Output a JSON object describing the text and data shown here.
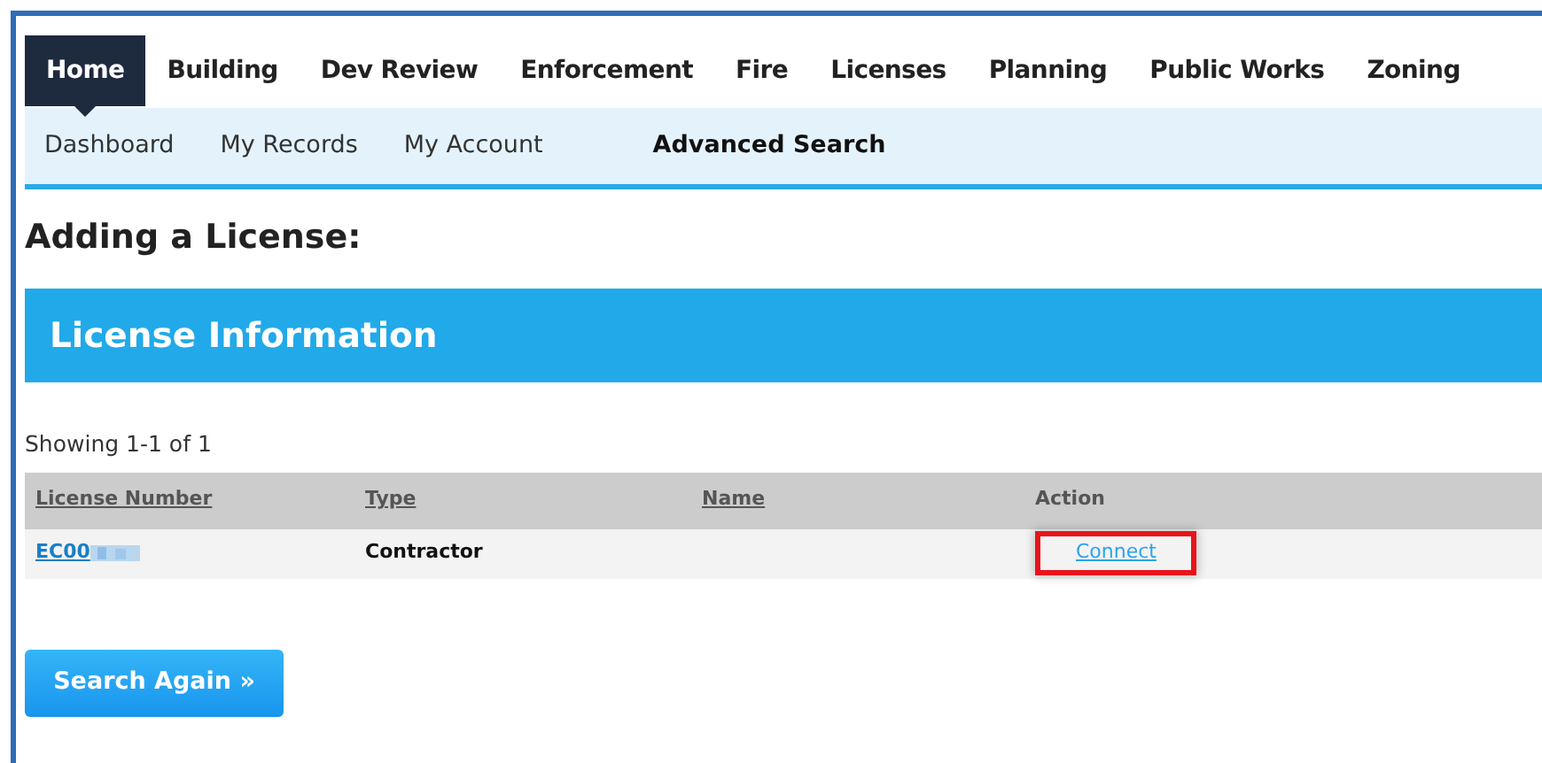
{
  "main_nav": [
    {
      "label": "Home",
      "selected": true
    },
    {
      "label": "Building",
      "selected": false
    },
    {
      "label": "Dev Review",
      "selected": false
    },
    {
      "label": "Enforcement",
      "selected": false
    },
    {
      "label": "Fire",
      "selected": false
    },
    {
      "label": "Licenses",
      "selected": false
    },
    {
      "label": "Planning",
      "selected": false
    },
    {
      "label": "Public Works",
      "selected": false
    },
    {
      "label": "Zoning",
      "selected": false
    }
  ],
  "sub_nav": [
    {
      "label": "Dashboard",
      "emphasized": false
    },
    {
      "label": "My Records",
      "emphasized": false
    },
    {
      "label": "My Account",
      "emphasized": false
    },
    {
      "label": "Advanced Search",
      "emphasized": true
    }
  ],
  "page_title": "Adding a License:",
  "section_title": "License Information",
  "results_count": "Showing 1-1 of 1",
  "table": {
    "columns": [
      "License Number",
      "Type",
      "Name",
      "Action"
    ],
    "rows": [
      {
        "license_number": "EC00",
        "license_number_redacted": true,
        "type": "Contractor",
        "action": "Connect",
        "action_highlighted": true
      }
    ]
  },
  "button": "Search Again »"
}
